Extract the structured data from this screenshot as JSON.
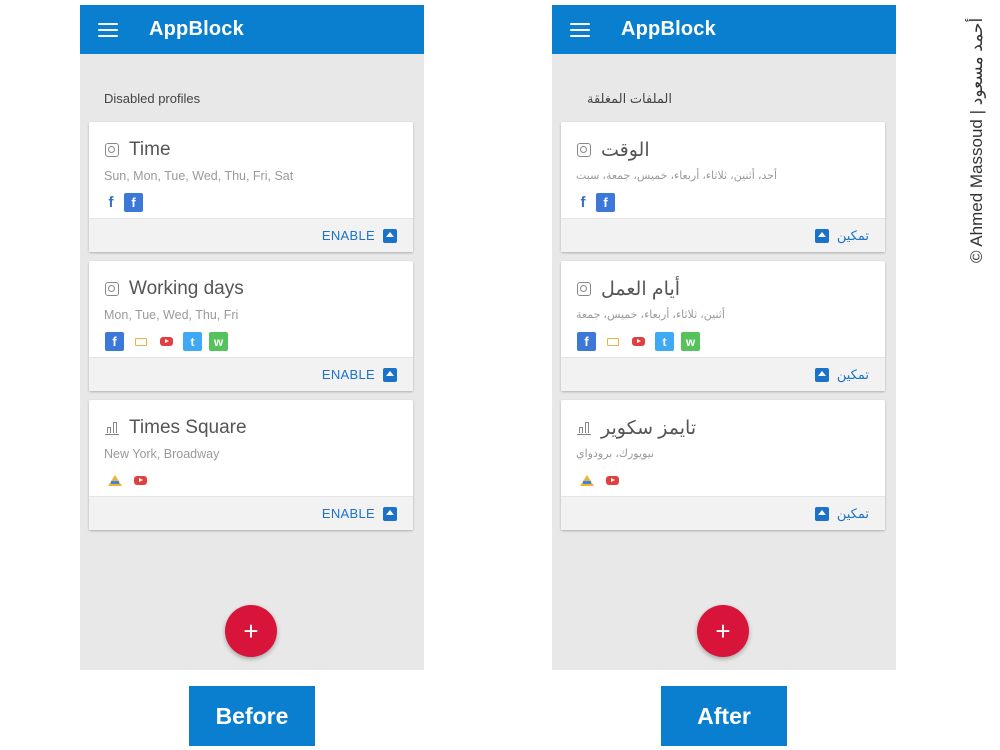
{
  "before": {
    "app_title": "AppBlock",
    "section_title": "Disabled profiles",
    "profiles": [
      {
        "name": "Time",
        "desc": "Sun, Mon, Tue, Wed, Thu, Fri, Sat",
        "icon": "clock-icon",
        "action": "ENABLE"
      },
      {
        "name": "Working days",
        "desc": "Mon, Tue, Wed, Thu, Fri",
        "icon": "clock-icon",
        "action": "ENABLE"
      },
      {
        "name": "Times Square",
        "desc": "New York, Broadway",
        "icon": "place-icon",
        "action": "ENABLE"
      }
    ],
    "fab": "+"
  },
  "after": {
    "app_title": "AppBlock",
    "section_title": "الملفات المغلقة",
    "profiles": [
      {
        "name": "الوقت",
        "desc": "أحد، أثنين، ثلاثاء، أربعاء، خميس، جمعة، سبت",
        "icon": "clock-icon",
        "action": "تمكين"
      },
      {
        "name": "أيام العمل",
        "desc": "أثنين، ثلاثاء، أربعاء، خميس، جمعة",
        "icon": "clock-icon",
        "action": "تمكين"
      },
      {
        "name": "تايمز سكوير",
        "desc": "نيويورك، برودواي",
        "icon": "place-icon",
        "action": "تمكين"
      }
    ],
    "fab": "+"
  },
  "labels": {
    "before": "Before",
    "after": "After"
  },
  "credit": "© Ahmed Massoud | أحمد مسعود",
  "colors": {
    "appbar": "#0a7fd0",
    "fab": "#d8143a",
    "enable": "#1a73c8",
    "background": "#e8e8e8"
  }
}
